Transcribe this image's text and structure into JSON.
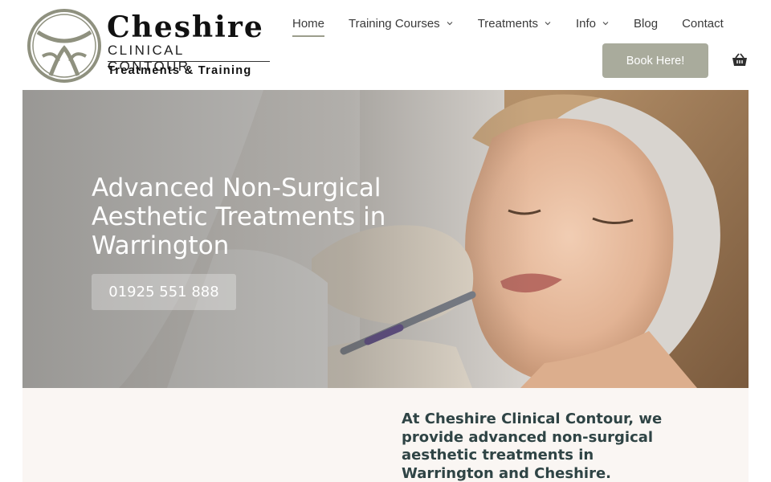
{
  "brand": {
    "name": "Cheshire",
    "subtitle": "CLINICAL CONTOUR",
    "tagline": "Treatments & Training"
  },
  "nav": {
    "items": [
      {
        "label": "Home",
        "active": true,
        "dropdown": false
      },
      {
        "label": "Training Courses",
        "active": false,
        "dropdown": true
      },
      {
        "label": "Treatments",
        "active": false,
        "dropdown": true
      },
      {
        "label": "Info",
        "active": false,
        "dropdown": true
      },
      {
        "label": "Blog",
        "active": false,
        "dropdown": false
      },
      {
        "label": "Contact",
        "active": false,
        "dropdown": false
      }
    ],
    "cta_label": "Book Here!",
    "basket_icon": "basket-icon"
  },
  "hero": {
    "title": "Advanced Non-Surgical Aesthetic Treatments in Warrington",
    "phone": "01925 551 888"
  },
  "intro": {
    "text": "At Cheshire Clinical Contour, we provide advanced non-surgical aesthetic treatments in Warrington and Cheshire."
  },
  "colors": {
    "accent": "#a9ab9c",
    "heading": "#2f4445",
    "intro_bg": "#faf6f3"
  }
}
